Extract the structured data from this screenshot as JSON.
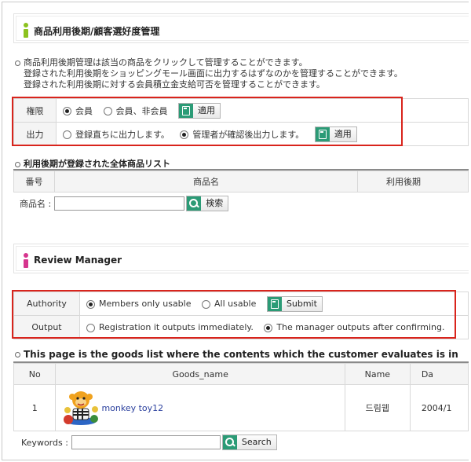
{
  "section1": {
    "title": "商品利用後期/顧客選好度管理",
    "description": [
      "商品利用後期管理は該当の商品をクリックして管理することができます。",
      "登録された利用後期をショッピングモール画面に出力するはずなのかを管理することができます。",
      "登録された利用後期に対する会員積立金支給可否を管理することができます。"
    ],
    "settings": {
      "authority_label": "権限",
      "authority_options": [
        "会員",
        "会員、非会員"
      ],
      "authority_selected": "会員",
      "output_label": "出力",
      "output_options": [
        "登録直ちに出力します。",
        "管理者が確認後出力します。"
      ],
      "output_selected": "管理者が確認後出力します。",
      "apply_label": "適用"
    },
    "list_title": "利用後期が登録された全体商品リスト",
    "columns": [
      "番号",
      "商品名",
      "利用後期"
    ],
    "search_label": "商品名 :",
    "search_value": "",
    "search_button": "検索"
  },
  "section2": {
    "title": "Review Manager",
    "settings": {
      "authority_label": "Authority",
      "authority_options": [
        "Members only usable",
        "All usable"
      ],
      "authority_selected": "Members only usable",
      "submit_label": "Submit",
      "output_label": "Output",
      "output_options": [
        "Registration it outputs immediately.",
        "The manager outputs after confirming."
      ],
      "output_selected": "The manager outputs after confirming."
    },
    "list_title": "This page is the goods list where the contents which the customer evaluates is in",
    "columns": [
      "No",
      "Goods_name",
      "Name",
      "Da"
    ],
    "rows": [
      {
        "no": "1",
        "goods_name": "monkey toy12",
        "name": "드림웹",
        "date": "2004/1"
      }
    ],
    "search_label": "Keywords :",
    "search_value": "",
    "search_button": "Search"
  },
  "colors": {
    "icon_green": "#8cc21f",
    "icon_magenta": "#d6358e",
    "button_icon": "#2b9b76",
    "highlight_red": "#d9241c"
  }
}
